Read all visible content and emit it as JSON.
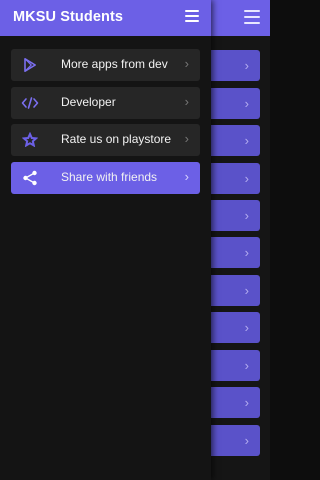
{
  "app": {
    "title": "MKSU Students"
  },
  "drawer": {
    "items": [
      {
        "label": "More apps from dev",
        "icon": "play-store-icon"
      },
      {
        "label": "Developer",
        "icon": "code-icon"
      },
      {
        "label": "Rate us on playstore",
        "icon": "star-icon"
      },
      {
        "label": "Share with friends",
        "icon": "share-icon",
        "selected": true
      }
    ]
  },
  "colors": {
    "accent": "#6c60e6",
    "card": "#5a52c9",
    "drawer_bg": "#141414",
    "item_bg": "#262626"
  }
}
